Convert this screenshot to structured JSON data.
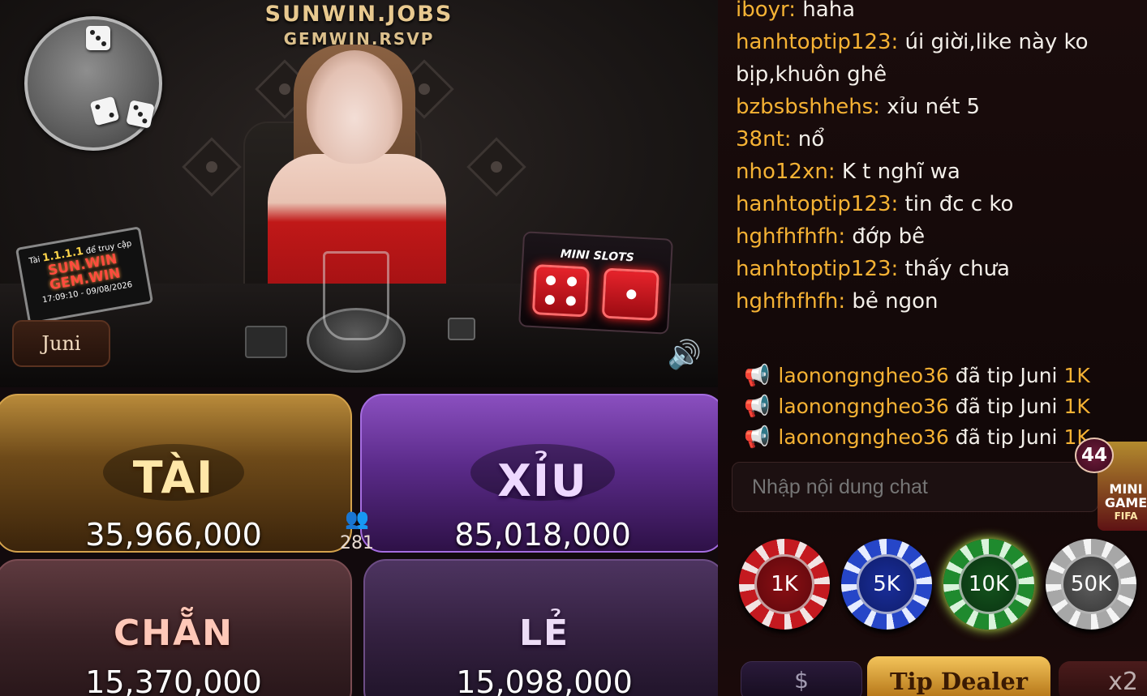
{
  "stream": {
    "watermark_line1": "SUNWIN.JOBS",
    "watermark_line2": "GEMWIN.RSVP",
    "sign_card": {
      "line1_prefix": "Tài",
      "line1_highlight": "1.1.1.1",
      "line1_suffix": "để truy cập",
      "brand1": "SUN.WIN",
      "brand2": "GEM.WIN",
      "timestamp": "17:09:10 - 09/08/2026"
    },
    "mini_slots_title": "MINI SLOTS",
    "dealer_name": "Juni",
    "speaker_icon": "speaker-icon"
  },
  "bets": {
    "tai": {
      "label": "TÀI",
      "amount": "35,966,000"
    },
    "xiu": {
      "label": "XỈU",
      "amount": "85,018,000"
    },
    "chan": {
      "label": "CHẴN",
      "amount": "15,370,000"
    },
    "le": {
      "label": "LẺ",
      "amount": "15,098,000"
    },
    "players_count": "281"
  },
  "chat": {
    "messages": [
      {
        "user": "iboyr:",
        "text": "haha"
      },
      {
        "user": "hanhtoptip123:",
        "text": "úi giời,like này ko bịp,khuôn ghê"
      },
      {
        "user": "bzbsbshhehs:",
        "text": "xỉu nét 5"
      },
      {
        "user": "38nt:",
        "text": "nổ"
      },
      {
        "user": "nho12xn:",
        "text": "K t nghĩ wa"
      },
      {
        "user": "hanhtoptip123:",
        "text": "tin đc c ko"
      },
      {
        "user": "hghfhfhfh:",
        "text": "đớp bê"
      },
      {
        "user": "hanhtoptip123:",
        "text": "thấy chưa"
      },
      {
        "user": "hghfhfhfh:",
        "text": "bẻ ngon"
      }
    ],
    "tips": [
      {
        "user": "laonongngheo36",
        "text": "đã tip Juni",
        "amount": "1K"
      },
      {
        "user": "laonongngheo36",
        "text": "đã tip Juni",
        "amount": "1K"
      },
      {
        "user": "laonongngheo36",
        "text": "đã tip Juni",
        "amount": "1K"
      }
    ],
    "input_placeholder": "Nhập nội dung chat",
    "badge_count": "44",
    "mini_game_line1": "MINI",
    "mini_game_line2": "GAME",
    "mini_game_line3": "FIFA"
  },
  "chips": [
    "1K",
    "5K",
    "10K",
    "50K"
  ],
  "controls": {
    "coin_symbol": "$",
    "tip_dealer_label": "Tip Dealer",
    "x2_label": "x2"
  },
  "colors": {
    "username": "#f5b234",
    "tai_accent": "#d4a24c",
    "xiu_accent": "#a56de0",
    "chip_1k": "#c41a20",
    "chip_5k": "#2646c8",
    "chip_10k": "#1f8a2e",
    "chip_50k": "#a7a7a7"
  }
}
